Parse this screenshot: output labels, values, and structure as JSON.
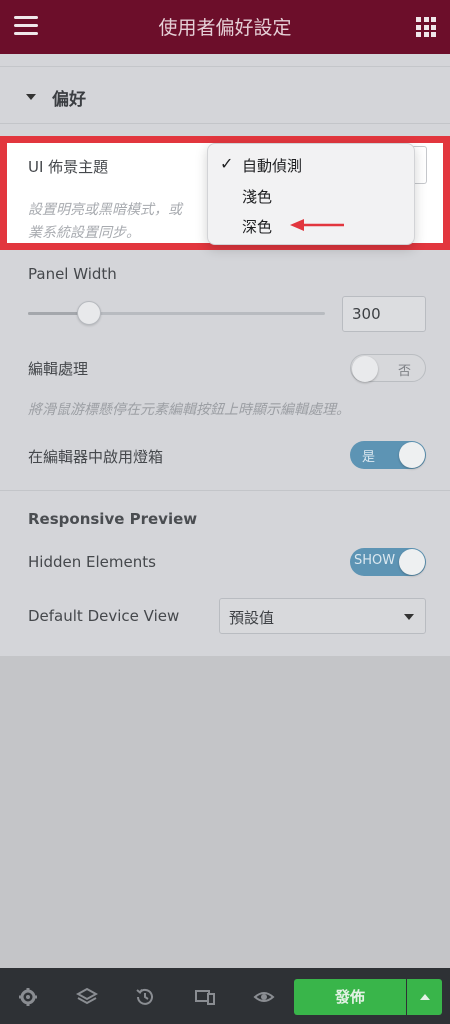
{
  "header": {
    "title": "使用者偏好設定",
    "menu_icon": "hamburger-menu-icon",
    "apps_icon": "grid-apps-icon"
  },
  "section": {
    "title": "偏好"
  },
  "ui_theme": {
    "label": "UI 佈景主題",
    "description_line1": "設置明亮或黑暗模式，或",
    "description_line2": "業系統設置同步。",
    "options": [
      "自動偵測",
      "淺色",
      "深色"
    ],
    "selected_index": 0,
    "check_mark": "✓"
  },
  "panel_width": {
    "label": "Panel Width",
    "value": "300",
    "slider_fraction": 0.21
  },
  "edit_handles": {
    "label": "編輯處理",
    "toggle_text": "否",
    "state": "off",
    "description": "將滑鼠游標懸停在元素編輯按鈕上時顯示編輯處理。"
  },
  "lightbox": {
    "label": "在編輯器中啟用燈箱",
    "toggle_text": "是",
    "state": "on"
  },
  "responsive": {
    "title": "Responsive Preview",
    "hidden_elements": {
      "label": "Hidden Elements",
      "toggle_text": "SHOW",
      "state": "on"
    },
    "default_device": {
      "label": "Default Device View",
      "value": "預設值"
    }
  },
  "bottom_bar": {
    "icons": [
      "settings-gear-icon",
      "layers-icon",
      "history-icon",
      "responsive-mode-icon",
      "preview-eye-icon"
    ],
    "publish_label": "發佈"
  },
  "colors": {
    "header_bg": "#6c0e2a",
    "highlight_border": "#e2363e",
    "toggle_on": "#5d94b4",
    "publish_green": "#39b54a",
    "arrow_red": "#e2363e"
  }
}
